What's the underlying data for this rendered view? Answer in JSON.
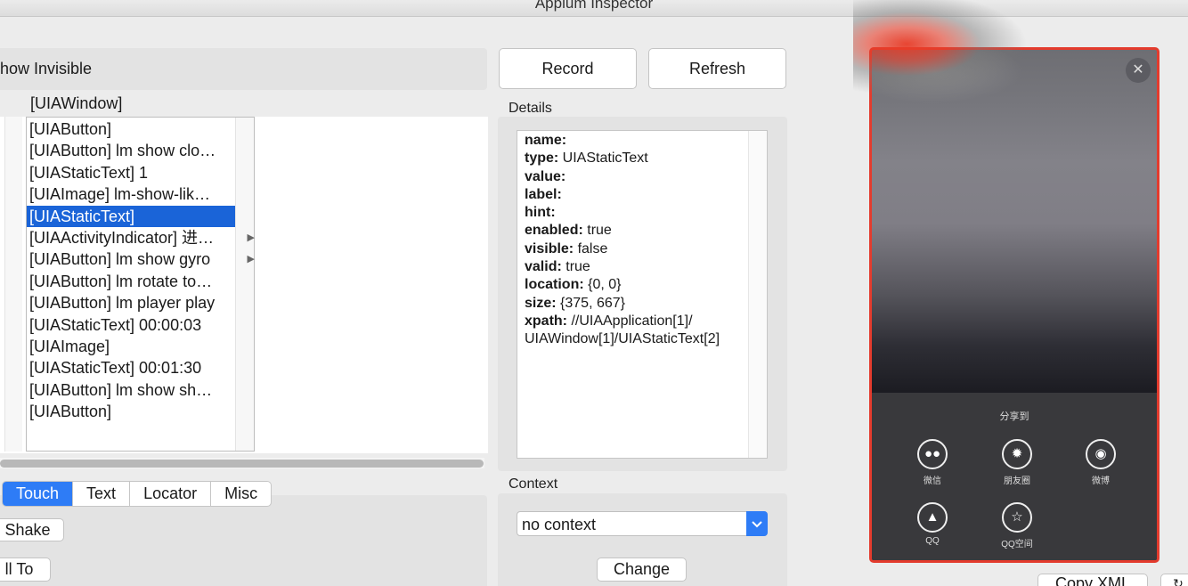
{
  "window": {
    "title": "Appium Inspector"
  },
  "toolbar": {
    "show_invisible_label": "how Invisible"
  },
  "tree": {
    "column_header": "[UIAWindow]",
    "items": [
      "[UIAButton]",
      "[UIAButton] lm show clo…",
      "[UIAStaticText] 1",
      "[UIAImage] lm-show-lik…",
      "[UIAStaticText]",
      "[UIAActivityIndicator] 进…",
      "[UIAButton] lm show gyro",
      "[UIAButton] lm rotate to…",
      "[UIAButton] lm player play",
      "[UIAStaticText] 00:00:03",
      "[UIAImage]",
      "[UIAStaticText] 00:01:30",
      "[UIAButton] lm show sh…",
      "[UIAButton]"
    ],
    "selected_index": 4
  },
  "tabs": [
    "Touch",
    "Text",
    "Locator",
    "Misc"
  ],
  "actions": {
    "shake": "Shake",
    "scroll_to": "ll To"
  },
  "buttons": {
    "record": "Record",
    "refresh": "Refresh",
    "change": "Change",
    "copy_xml": "Copy XML"
  },
  "details": {
    "label": "Details",
    "fields": [
      {
        "key": "name:",
        "value": ""
      },
      {
        "key": "type:",
        "value": " UIAStaticText"
      },
      {
        "key": "value:",
        "value": ""
      },
      {
        "key": "label:",
        "value": ""
      },
      {
        "key": "hint:",
        "value": ""
      },
      {
        "key": "enabled:",
        "value": " true"
      },
      {
        "key": "visible:",
        "value": " false"
      },
      {
        "key": "valid:",
        "value": " true"
      },
      {
        "key": "location:",
        "value": " {0, 0}"
      },
      {
        "key": "size:",
        "value": " {375, 667}"
      },
      {
        "key": "xpath:",
        "value": " //UIAApplication[1]/"
      }
    ],
    "xpath_continuation": "UIAWindow[1]/UIAStaticText[2]"
  },
  "context": {
    "label": "Context",
    "selected": "no context"
  },
  "device_preview": {
    "share_title": "分享到",
    "share_targets": [
      {
        "label": "微信",
        "icon": "wechat-icon"
      },
      {
        "label": "朋友圈",
        "icon": "moments-icon"
      },
      {
        "label": "微博",
        "icon": "weibo-icon"
      },
      {
        "label": "QQ",
        "icon": "qq-icon"
      },
      {
        "label": "QQ空间",
        "icon": "qzone-icon"
      }
    ],
    "border_color": "#e33b2d"
  },
  "colors": {
    "selection": "#1a64d8",
    "accent": "#2e7cf6"
  }
}
